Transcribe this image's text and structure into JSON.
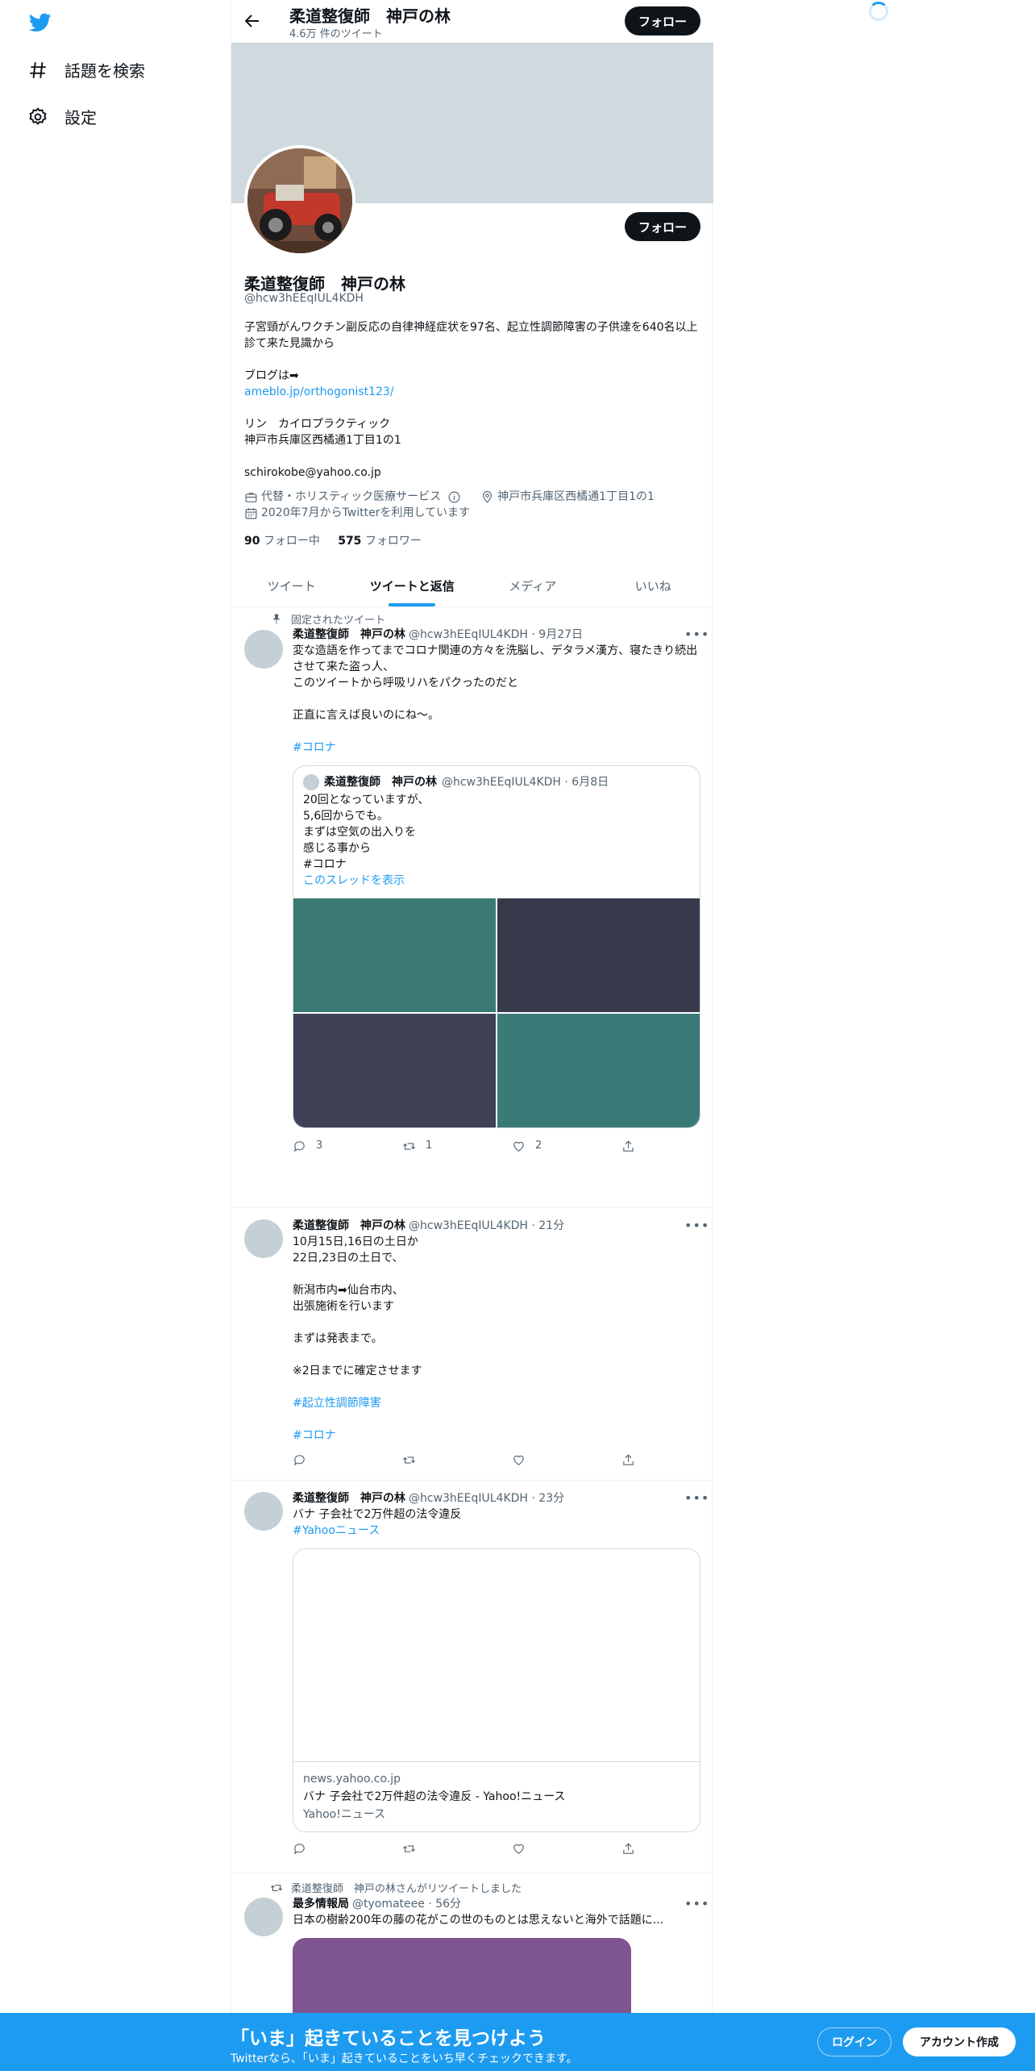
{
  "nav": {
    "explore_label": "話題を検索",
    "settings_label": "設定"
  },
  "header": {
    "name": "柔道整復師　神戸の林",
    "tweet_count": "4.6万 件のツイート",
    "follow_label": "フォロー"
  },
  "profile": {
    "name": "柔道整復師　神戸の林",
    "handle": "@hcw3hEEqIUL4KDH",
    "follow_label": "フォロー",
    "bio": [
      "子宮頸がんワクチン副反応の自律神経症状を97名、起立性調節障害の子供達を640名以上診て来た見識から",
      "",
      "ブログは➡",
      "ameblo.jp/orthogonist123/",
      "",
      "リン　カイロプラクティック",
      "神戸市兵庫区西橘通1丁目1の1",
      "",
      "schirokobe@yahoo.co.jp"
    ],
    "category": "代替・ホリスティック医療サービス",
    "location": "神戸市兵庫区西橘通1丁目1の1",
    "joined": "2020年7月からTwitterを利用しています",
    "following_count": "90",
    "following_label": "フォロー中",
    "followers_count": "575",
    "followers_label": "フォロワー"
  },
  "tabs": [
    "ツイート",
    "ツイートと返信",
    "メディア",
    "いいね"
  ],
  "tweets": [
    {
      "context": "固定されたツイート",
      "name": "柔道整復師　神戸の林",
      "handle_time": "@hcw3hEEqIUL4KDH · 9月27日",
      "text": [
        "変な造語を作ってまでコロナ関連の方々を洗脳し、デタラメ漢方、寝たきり続出させて来た盗っ人、",
        "このツイートから呼吸リハをパクったのだと",
        "",
        "正直に言えば良いのにね〜。",
        ""
      ],
      "hashtag": "#コロナ",
      "quote": {
        "name": "柔道整復師　神戸の林",
        "handle_time": "@hcw3hEEqIUL4KDH · 6月8日",
        "text": [
          "20回となっていますが、",
          "5,6回からでも。",
          "",
          "まずは空気の出入りを",
          "感じる事から",
          "",
          "#コロナ"
        ],
        "show_thread": "このスレッドを表示",
        "image_colors": [
          "#3a7a72",
          "#363a4a",
          "#3f4156",
          "#3b7b77"
        ]
      },
      "replies": "3",
      "retweets": "1",
      "likes": "2"
    },
    {
      "name": "柔道整復師　神戸の林",
      "handle_time": "@hcw3hEEqIUL4KDH · 21分",
      "text": [
        "10月15日,16日の土日か",
        "22日,23日の土日で、",
        "",
        "新潟市内➡仙台市内、",
        "出張施術を行います",
        "",
        "まずは発表まで。",
        "",
        "※2日までに確定させます",
        ""
      ],
      "hashtags": [
        "#起立性調節障害",
        "#コロナ"
      ]
    },
    {
      "name": "柔道整復師　神戸の林",
      "handle_time": "@hcw3hEEqIUL4KDH · 23分",
      "text": [
        "バナ 子会社で2万件超の法令違反"
      ],
      "hashtag": "#Yahooニュース",
      "card": {
        "domain": "news.yahoo.co.jp",
        "title": "バナ 子会社で2万件超の法令違反 - Yahoo!ニュース",
        "source": "Yahoo!ニュース"
      }
    },
    {
      "context": "柔道整復師　神戸の林さんがリツイートしました",
      "name": "最多情報局",
      "handle_time": "@tyomateee · 56分",
      "text": [
        "日本の樹齢200年の藤の花がこの世のものとは思えないと海外で話題に..."
      ],
      "image_color": "#7f5591"
    }
  ],
  "bottom": {
    "title": "「いま」起きていることを見つけよう",
    "subtitle": "Twitterなら、「いま」起きていることをいち早くチェックできます。",
    "login": "ログイン",
    "signup": "アカウント作成"
  },
  "colors": {
    "accent": "#1d9bf0",
    "banner": "#cfd9de"
  }
}
